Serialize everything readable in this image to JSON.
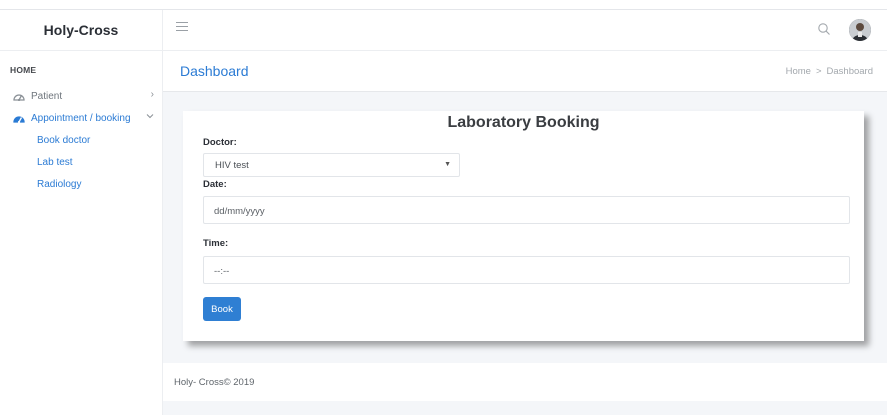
{
  "app": {
    "brand": "Holy-Cross"
  },
  "sidebar": {
    "heading": "HOME",
    "items": [
      {
        "label": "Patient",
        "icon": "dashboard-gauge-icon",
        "chevron": ">"
      },
      {
        "label": "Appointment / booking",
        "icon": "dashboard-gauge-icon",
        "chevron": "v",
        "active": true
      }
    ],
    "subitems": [
      {
        "label": "Book doctor"
      },
      {
        "label": "Lab test"
      },
      {
        "label": "Radiology"
      }
    ]
  },
  "header": {
    "menu_icon": "hamburger-icon",
    "search_icon": "search-icon",
    "avatar_icon": "user-avatar"
  },
  "titlebar": {
    "title": "Dashboard",
    "breadcrumb": {
      "home": "Home",
      "separator": ">",
      "current": "Dashboard"
    }
  },
  "form": {
    "title": "Laboratory Booking",
    "doctor_label": "Doctor:",
    "doctor_value": "HIV test",
    "date_label": "Date:",
    "date_placeholder": "dd/mm/yyyy",
    "time_label": "Time:",
    "time_placeholder": "--:--",
    "book_label": "Book"
  },
  "footer": {
    "text": "Holy- Cross© 2019"
  },
  "colors": {
    "accent": "#2b7bd4",
    "button": "#2f7fd3",
    "background": "#f4f6f9",
    "text_dark": "#2b2f36"
  }
}
